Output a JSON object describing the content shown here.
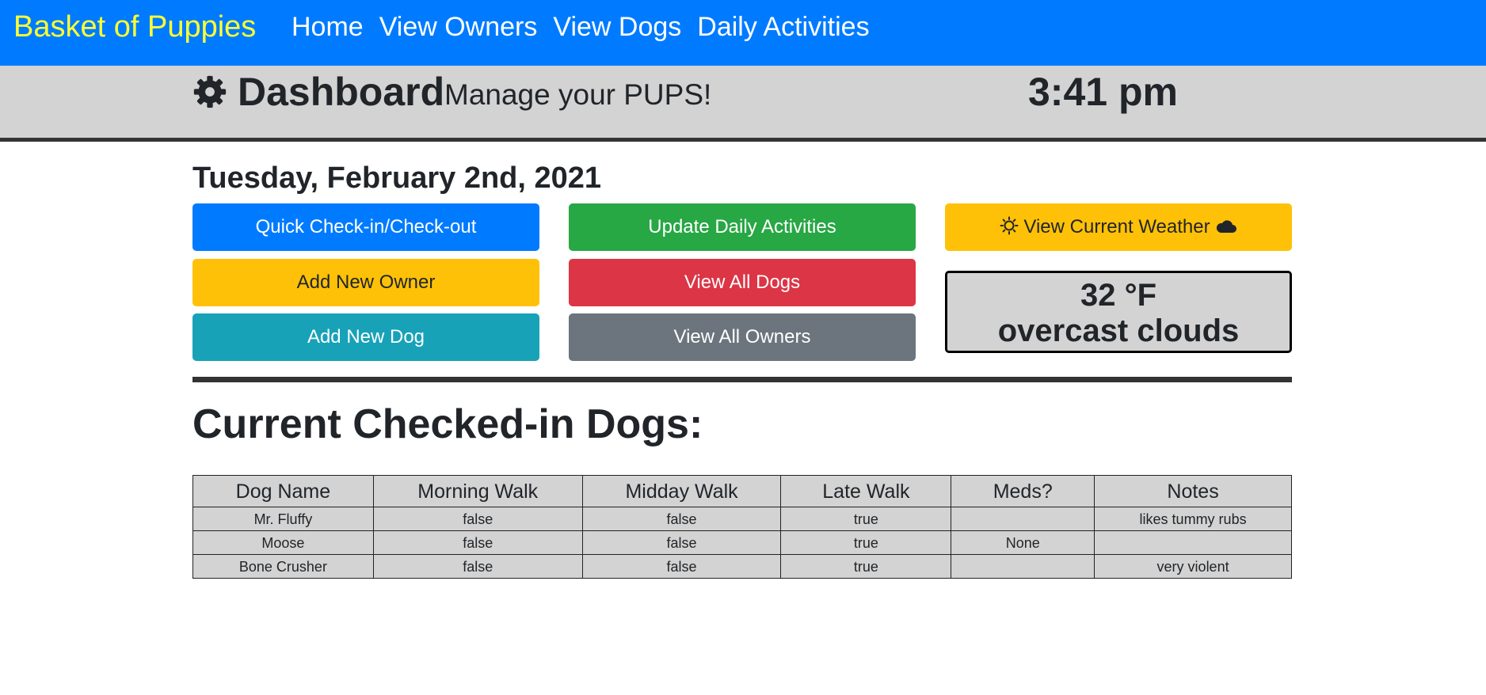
{
  "navbar": {
    "brand": "Basket of Puppies",
    "links": [
      "Home",
      "View Owners",
      "View Dogs",
      "Daily Activities"
    ]
  },
  "header": {
    "title": "Dashboard",
    "subtitle": "Manage your PUPS!",
    "time": "3:41 pm",
    "icon": "gear-icon"
  },
  "date": "Tuesday, February 2nd, 2021",
  "buttons": {
    "checkin": "Quick Check-in/Check-out",
    "update_activities": "Update Daily Activities",
    "weather": "View Current Weather",
    "add_owner": "Add New Owner",
    "view_dogs": "View All Dogs",
    "add_dog": "Add New Dog",
    "view_owners": "View All Owners"
  },
  "weather": {
    "temp": "32 °F",
    "description": "overcast clouds"
  },
  "checked_in": {
    "title": "Current Checked-in Dogs:",
    "columns": [
      "Dog Name",
      "Morning Walk",
      "Midday Walk",
      "Late Walk",
      "Meds?",
      "Notes"
    ],
    "rows": [
      [
        "Mr. Fluffy",
        "false",
        "false",
        "true",
        "",
        "likes tummy rubs"
      ],
      [
        "Moose",
        "false",
        "false",
        "true",
        "None",
        ""
      ],
      [
        "Bone Crusher",
        "false",
        "false",
        "true",
        "",
        "very violent"
      ]
    ]
  },
  "colors": {
    "navbar": "#007bff",
    "brand": "#ffff33",
    "banner": "#d3d3d3",
    "primary": "#007bff",
    "success": "#28a745",
    "warning": "#ffc107",
    "danger": "#dc3545",
    "info": "#17a2b8",
    "secondary": "#6c757d"
  }
}
